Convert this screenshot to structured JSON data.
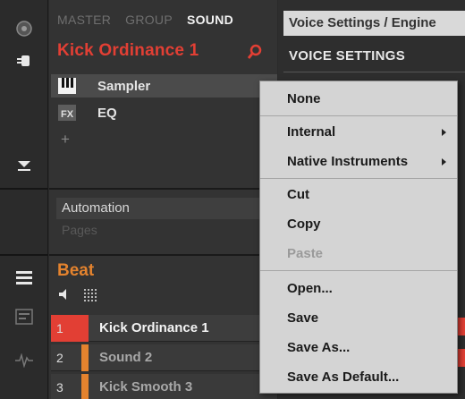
{
  "top_tabs": {
    "master": "MASTER",
    "group": "GROUP",
    "sound": "SOUND"
  },
  "sound_title": "Kick Ordinance 1",
  "plugins": [
    {
      "label": "Sampler",
      "icon": "keyboard-icon"
    },
    {
      "label": "EQ",
      "icon": "fx-icon"
    }
  ],
  "add_label": "+",
  "automation_label": "Automation",
  "pages_label": "Pages",
  "group_title": "Beat",
  "sounds": [
    {
      "num": "1",
      "name": "Kick Ordinance 1"
    },
    {
      "num": "2",
      "name": "Sound 2"
    },
    {
      "num": "3",
      "name": "Kick Smooth 3"
    }
  ],
  "right_panel": {
    "header": "Voice Settings / Engine",
    "subheader": "VOICE SETTINGS"
  },
  "context_menu": {
    "items": [
      {
        "label": "None"
      },
      {
        "label": "Internal",
        "submenu": true
      },
      {
        "label": "Native Instruments",
        "submenu": true
      },
      {
        "label": "Cut"
      },
      {
        "label": "Copy"
      },
      {
        "label": "Paste",
        "disabled": true
      },
      {
        "label": "Open..."
      },
      {
        "label": "Save"
      },
      {
        "label": "Save As..."
      },
      {
        "label": "Save As Default..."
      }
    ]
  },
  "colors": {
    "sound_accent": "#e23f34",
    "group_accent": "#e4832e",
    "menu_bg": "#d4d4d4"
  }
}
